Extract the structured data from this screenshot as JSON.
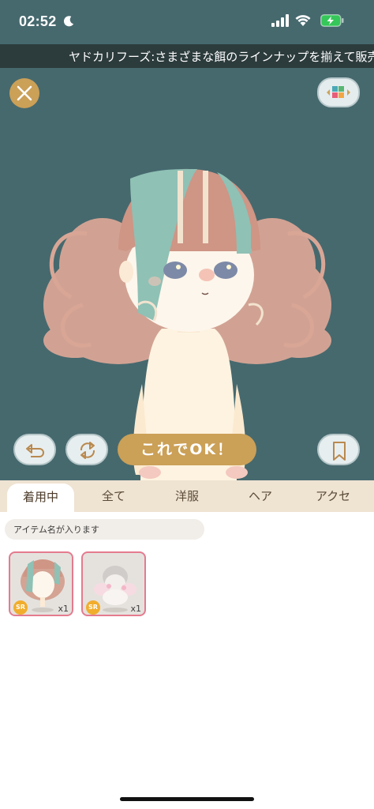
{
  "status_bar": {
    "time": "02:52"
  },
  "ticker": {
    "text": "ヤドカリフーズ:さまざまな餌のラインナップを揃えて販売"
  },
  "stage": {
    "ok_label": "これでOK！",
    "colors": {
      "background": "#46696e",
      "accent": "#cba057"
    }
  },
  "tabs": [
    {
      "label": "着用中",
      "active": true
    },
    {
      "label": "全て",
      "active": false
    },
    {
      "label": "洋服",
      "active": false
    },
    {
      "label": "ヘア",
      "active": false
    },
    {
      "label": "アクセ",
      "active": false
    }
  ],
  "search": {
    "placeholder": "アイテム名が入ります"
  },
  "items": [
    {
      "rarity": "SR",
      "count": "x1"
    },
    {
      "rarity": "SR",
      "count": "x1"
    }
  ]
}
